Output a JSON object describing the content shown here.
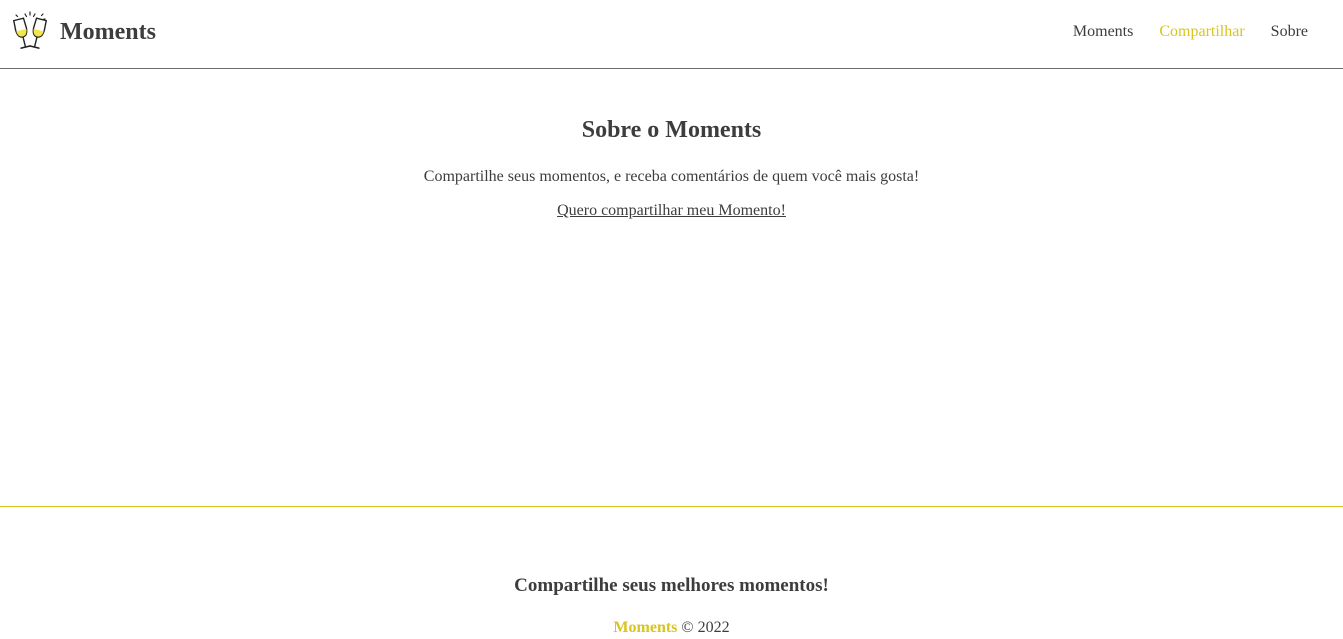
{
  "colors": {
    "accent": "#d8c51e",
    "text": "#3d3d3d",
    "header_border": "#6b6b6b"
  },
  "header": {
    "logo_icon": "champagne-toast-icon",
    "brand_name": "Moments",
    "nav": {
      "moments": "Moments",
      "compartilhar": "Compartilhar",
      "sobre": "Sobre"
    },
    "active_nav": "Compartilhar"
  },
  "main": {
    "title": "Sobre o Moments",
    "description": "Compartilhe seus momentos, e receba comentários de quem você mais gosta!",
    "cta_link": "Quero compartilhar meu Momento!"
  },
  "footer": {
    "tagline": "Compartilhe seus melhores momentos!",
    "brand": "Moments",
    "copyright": "© 2022"
  }
}
